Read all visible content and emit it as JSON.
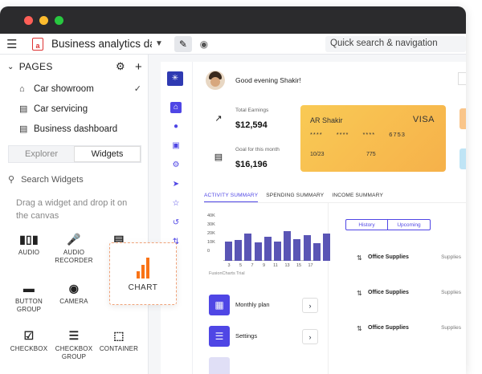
{
  "appbar": {
    "title": "Business analytics das…",
    "search_placeholder": "Quick search & navigation",
    "logo_letter": "a"
  },
  "sidebar": {
    "pages_label": "PAGES",
    "pages": [
      {
        "label": "Car showroom",
        "icon": "home-icon",
        "selected": true
      },
      {
        "label": "Car servicing",
        "icon": "page-icon",
        "selected": false
      },
      {
        "label": "Business dashboard",
        "icon": "page-icon",
        "selected": false
      }
    ],
    "tab_explorer": "Explorer",
    "tab_widgets": "Widgets",
    "search_widgets": "Search Widgets",
    "drag_hint": "Drag a widget and drop it on the canvas",
    "widgets": [
      {
        "label": "AUDIO",
        "icon": "audio-icon"
      },
      {
        "label": "AUDIO RECORDER",
        "icon": "microphone-icon"
      },
      {
        "label": "BUTTON GROUP",
        "icon": "button-group-icon"
      },
      {
        "label": "CAMERA",
        "icon": "camera-icon"
      },
      {
        "label": "CHECKBOX",
        "icon": "checkbox-icon"
      },
      {
        "label": "CHECKBOX GROUP",
        "icon": "checkbox-group-icon"
      },
      {
        "label": "CONTAINER",
        "icon": "container-icon"
      }
    ],
    "dragging_widget": {
      "label": "CHART",
      "icon": "chart-icon",
      "accent": "#f97316"
    }
  },
  "dashboard": {
    "greeting": "Good evening Shakir!",
    "stats": [
      {
        "label": "Total Earnings",
        "value": "$12,594",
        "icon": "trend-up-icon",
        "color": "#a8d5a2"
      },
      {
        "label": "Goal for this month",
        "value": "$16,196",
        "icon": "cash-icon",
        "color": "#e5e7eb"
      }
    ],
    "card": {
      "holder": "AR Shakir",
      "brand": "VISA",
      "number": "**** **** **** 6753",
      "expiry": "10/23",
      "cvv": "775"
    },
    "tabs": [
      "ACTIVITY SUMMARY",
      "SPENDING SUMMARY",
      "INCOME SUMMARY"
    ],
    "active_tab": 0,
    "chart_credit": "FusionCharts Trial",
    "menu": [
      {
        "label": "Monthly plan",
        "icon": "calendar-icon"
      },
      {
        "label": "Settings",
        "icon": "sliders-icon"
      }
    ],
    "history_label": "History",
    "upcoming_label": "Upcoming",
    "transactions": [
      {
        "label": "Office Supplies",
        "category": "Supplies"
      },
      {
        "label": "Office Supplies",
        "category": "Supplies"
      },
      {
        "label": "Office Supplies",
        "category": "Supplies"
      }
    ]
  },
  "chart_data": {
    "type": "bar",
    "categories": [
      "3",
      "4",
      "5",
      "6",
      "7",
      "8",
      "9",
      "10",
      "11",
      "12",
      "13",
      "14",
      "15",
      "16",
      "17"
    ],
    "values": [
      22000,
      24000,
      31000,
      21000,
      27000,
      22000,
      34000,
      25000,
      29000,
      20000,
      31000
    ],
    "visible_x_ticks": [
      "3",
      "5",
      "7",
      "9",
      "11",
      "13",
      "15",
      "17"
    ],
    "yticks": [
      "40K",
      "30K",
      "20K",
      "10K",
      "0"
    ],
    "ylim": [
      0,
      40000
    ],
    "color": "#5a55b5"
  }
}
